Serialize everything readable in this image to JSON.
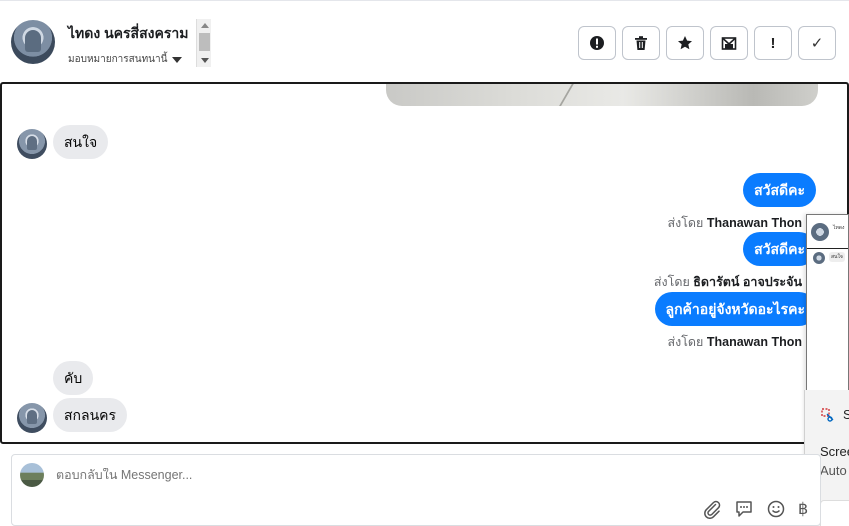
{
  "header": {
    "contact_name": "ไทดง นครสี่สงคราม",
    "assign_label": "มอบหมายการสนทนานี้",
    "actions": [
      {
        "icon": "alert-circle-icon",
        "label": ""
      },
      {
        "icon": "trash-icon",
        "label": ""
      },
      {
        "icon": "star-icon",
        "label": ""
      },
      {
        "icon": "mail-x-icon",
        "label": ""
      },
      {
        "icon": "exclamation-icon",
        "label": "!"
      },
      {
        "icon": "check-icon",
        "label": "✓"
      }
    ]
  },
  "messages": {
    "m1_in": "สนใจ",
    "m2_out": "สวัสดีคะ",
    "m2_sender_prefix": "ส่งโดย",
    "m2_sender": "Thanawan Thon",
    "m3_out": "สวัสดีคะ",
    "m3_sender_prefix": "ส่งโดย",
    "m3_sender": "ธิดารัตน์ อาจประจัน",
    "m4_out": "ลูกค้าอยู่จังหวัดอะไรคะ",
    "m4_sender_prefix": "ส่งโดย",
    "m4_sender": "Thanawan Thon",
    "m5_in": "คับ",
    "m6_in": "สกลนคร"
  },
  "side_panel": {
    "thumb_title": "ไทดง",
    "thumb_msg": "สนใจ",
    "snip_letter": "S",
    "snip_line1": "Scree",
    "snip_line2": "Auto"
  },
  "composer": {
    "placeholder": "ตอบกลับใน Messenger...",
    "baht_symbol": "฿"
  },
  "colors": {
    "outgoing_bubble": "#0a7cff",
    "incoming_bubble": "#e9eaed"
  }
}
